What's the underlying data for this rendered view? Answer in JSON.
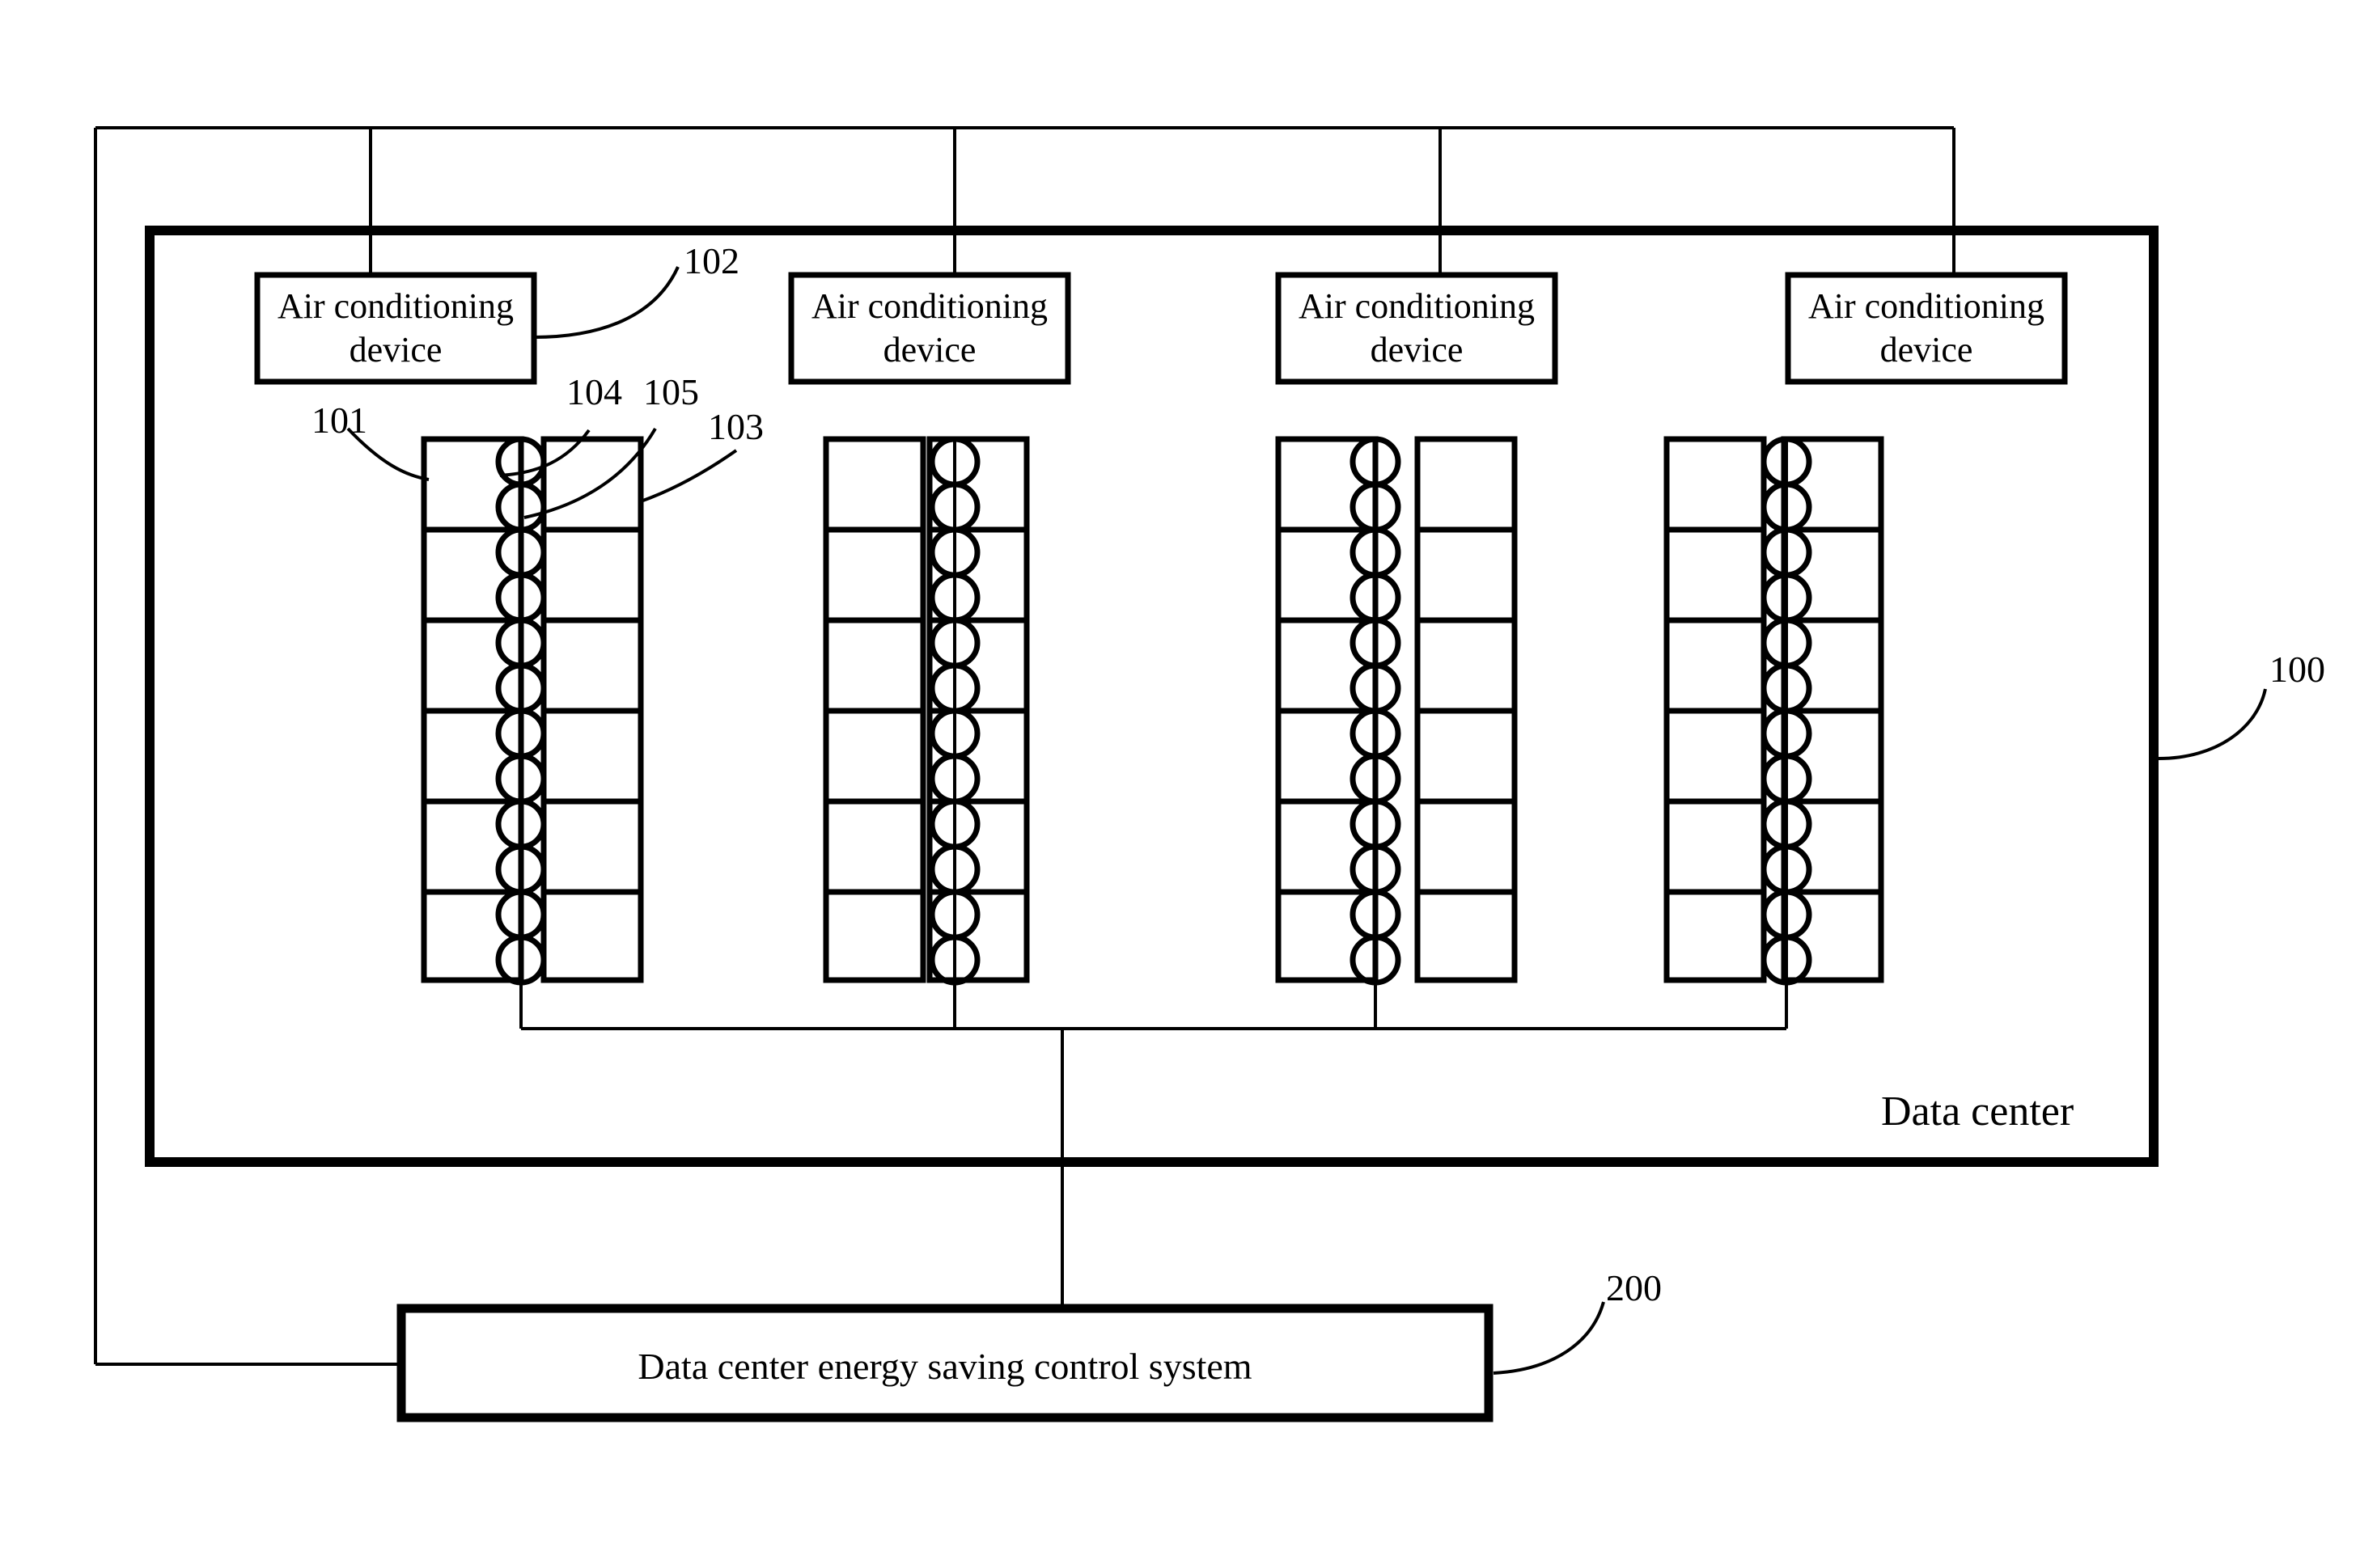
{
  "figure": {
    "type": "patent-block-diagram",
    "background": "#ffffff",
    "line_color": "#000000"
  },
  "data_center": {
    "label": "Data center",
    "reference_numeral": "100"
  },
  "air_conditioning_devices": [
    {
      "label": "Air conditioning device",
      "reference_numeral": "102"
    },
    {
      "label": "Air conditioning device",
      "reference_numeral": ""
    },
    {
      "label": "Air conditioning device",
      "reference_numeral": ""
    },
    {
      "label": "Air conditioning device",
      "reference_numeral": ""
    }
  ],
  "rack_groups": [
    {
      "name": "rack-group-1",
      "left_column_cells": 6,
      "right_column_cells": 6,
      "fans_per_cell": 2
    },
    {
      "name": "rack-group-2",
      "left_column_cells": 6,
      "right_column_cells": 6,
      "fans_per_cell": 2
    },
    {
      "name": "rack-group-3",
      "left_column_cells": 6,
      "right_column_cells": 6,
      "fans_per_cell": 2
    },
    {
      "name": "rack-group-4",
      "left_column_cells": 6,
      "right_column_cells": 6,
      "fans_per_cell": 2
    }
  ],
  "control_system": {
    "label": "Data center energy saving control system",
    "reference_numeral": "200"
  },
  "reference_numerals": {
    "server_rack": "101",
    "air_conditioning_device": "102",
    "server_rack_right": "103",
    "fan_upper": "104",
    "fan_lower": "105",
    "data_center": "100",
    "control_system": "200"
  },
  "callouts": [
    {
      "id": "101",
      "text": "101"
    },
    {
      "id": "102",
      "text": "102"
    },
    {
      "id": "103",
      "text": "103"
    },
    {
      "id": "104",
      "text": "104"
    },
    {
      "id": "105",
      "text": "105"
    },
    {
      "id": "100",
      "text": "100"
    },
    {
      "id": "200",
      "text": "200"
    }
  ]
}
